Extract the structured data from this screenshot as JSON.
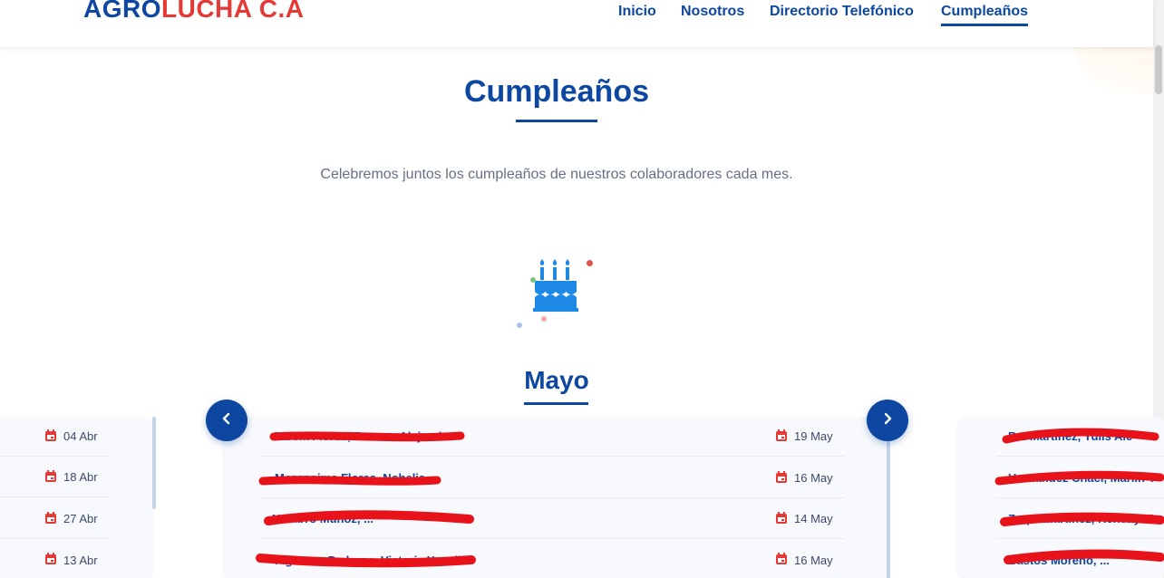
{
  "brand": {
    "part1": "AGRO",
    "part2": "LUCHA C.A"
  },
  "nav": [
    {
      "label": "Inicio",
      "active": false
    },
    {
      "label": "Nosotros",
      "active": false
    },
    {
      "label": "Directorio Telefónico",
      "active": false
    },
    {
      "label": "Cumpleaños",
      "active": true
    }
  ],
  "header": {
    "title": "Cumpleaños",
    "subtitle": "Celebremos juntos los cumpleaños de nuestros colaboradores cada mes."
  },
  "icons": {
    "cake": "birthday-cake-icon",
    "calendar": "calendar-icon",
    "prev": "chevron-left-icon",
    "next": "chevron-right-icon"
  },
  "colors": {
    "primary": "#0d47a1",
    "accent": "#e53935",
    "cake": "#1e88e5"
  },
  "carousel": {
    "month": "Mayo",
    "prev_cards": [
      {
        "date": "04 Abr"
      },
      {
        "date": "18 Abr"
      },
      {
        "date": "27 Abr"
      },
      {
        "date": "13 Abr"
      }
    ],
    "current": [
      {
        "name": "García Flores, Rosana Alejandra",
        "date": "19 May"
      },
      {
        "name": "Morocoima Flores, Nohelia",
        "date": "16 May"
      },
      {
        "name": "Navarro Muñoz, ...",
        "date": "14 May"
      },
      {
        "name": "Figueroa Pedrozo, Victoria Yaneilin",
        "date": "16 May"
      }
    ],
    "next_cards": [
      {
        "name": "B... Martínez, Yulis Ale"
      },
      {
        "name": "Hernández Chací, Marlin Y"
      },
      {
        "name": "Zerpa Martínez, Kenedy M"
      },
      {
        "name": "Bastos Moreno, ..."
      }
    ]
  }
}
